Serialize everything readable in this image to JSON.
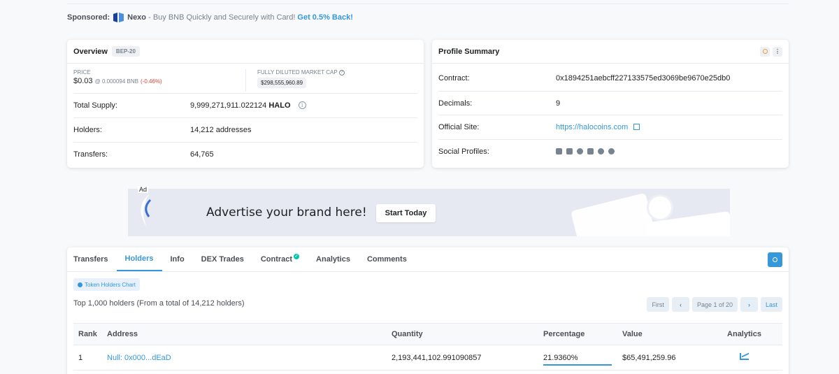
{
  "sponsored": {
    "label": "Sponsored:",
    "brand": "Nexo",
    "separator": " - ",
    "text": "Buy BNB Quickly and Securely with Card!",
    "cta": "Get 0.5% Back!"
  },
  "overview": {
    "title": "Overview",
    "badge": "BEP-20",
    "price_label": "PRICE",
    "price": "$0.03",
    "price_bnb": "@ 0.000094 BNB",
    "price_change": "(-0.46%)",
    "mcap_label": "FULLY DILUTED MARKET CAP",
    "mcap_value": "$298,555,960.89",
    "total_supply_label": "Total Supply:",
    "total_supply_value": "9,999,271,911.022124",
    "total_supply_symbol": "HALO",
    "holders_label": "Holders:",
    "holders_value": "14,212 addresses",
    "transfers_label": "Transfers:",
    "transfers_value": "64,765"
  },
  "profile": {
    "title": "Profile Summary",
    "contract_label": "Contract:",
    "contract_value": "0x1894251aebcff227133575ed3069be9670e25db0",
    "decimals_label": "Decimals:",
    "decimals_value": "9",
    "site_label": "Official Site:",
    "site_value": "https://halocoins.com",
    "social_label": "Social Profiles:",
    "social_icons": [
      "email-icon",
      "twitter-icon",
      "telegram-icon",
      "document-icon",
      "github-icon",
      "coinmarketcap-icon"
    ]
  },
  "ad": {
    "label": "Ad",
    "text": "Advertise your brand here!",
    "button": "Start Today"
  },
  "tabs": [
    {
      "label": "Transfers",
      "active": false
    },
    {
      "label": "Holders",
      "active": true
    },
    {
      "label": "Info",
      "active": false
    },
    {
      "label": "DEX Trades",
      "active": false
    },
    {
      "label": "Contract",
      "active": false,
      "verified": true
    },
    {
      "label": "Analytics",
      "active": false
    },
    {
      "label": "Comments",
      "active": false
    }
  ],
  "holders": {
    "chart_button": "Token Holders Chart",
    "summary": "Top 1,000 holders (From a total of 14,212 holders)",
    "pager": {
      "first": "First",
      "prev": "‹",
      "page": "Page 1 of 20",
      "next": "›",
      "last": "Last"
    },
    "columns": [
      "Rank",
      "Address",
      "Quantity",
      "Percentage",
      "Value",
      "Analytics"
    ],
    "rows": [
      {
        "rank": "1",
        "address": "Null: 0x000...dEaD",
        "quantity": "2,193,441,102.991090857",
        "percentage": "21.9360%",
        "percentage_fill": 1.0,
        "value": "$65,491,259.96"
      }
    ]
  }
}
